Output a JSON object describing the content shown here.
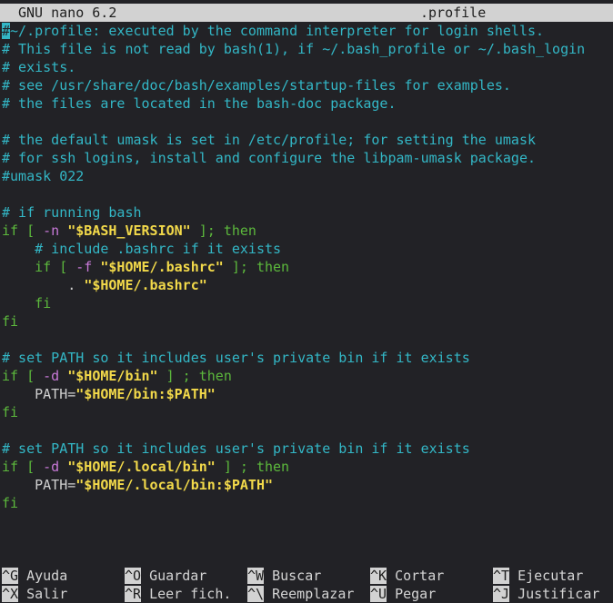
{
  "header": {
    "app_name": "GNU nano 6.2",
    "file_name": ".profile"
  },
  "editor": {
    "lines": [
      [
        [
          "cm",
          "~/.profile: executed by the command interpreter for login shells."
        ]
      ],
      [
        [
          "cm",
          "# This file is not read by bash(1), if ~/.bash_profile or ~/.bash_login"
        ]
      ],
      [
        [
          "cm",
          "# exists."
        ]
      ],
      [
        [
          "cm",
          "# see /usr/share/doc/bash/examples/startup-files for examples."
        ]
      ],
      [
        [
          "cm",
          "# the files are located in the bash-doc package."
        ]
      ],
      [],
      [
        [
          "cm",
          "# the default umask is set in /etc/profile; for setting the umask"
        ]
      ],
      [
        [
          "cm",
          "# for ssh logins, install and configure the libpam-umask package."
        ]
      ],
      [
        [
          "cm",
          "#umask 022"
        ]
      ],
      [],
      [
        [
          "cm",
          "# if running bash"
        ]
      ],
      [
        [
          "kw",
          "if"
        ],
        [
          "kw",
          " [ "
        ],
        [
          "op",
          "-n"
        ],
        [
          "pl",
          " "
        ],
        [
          "st",
          "\"$BASH_VERSION\""
        ],
        [
          "kw",
          " ]; then"
        ]
      ],
      [
        [
          "pl",
          "    "
        ],
        [
          "cm",
          "# include .bashrc if it exists"
        ]
      ],
      [
        [
          "pl",
          "    "
        ],
        [
          "kw",
          "if"
        ],
        [
          "kw",
          " [ "
        ],
        [
          "op",
          "-f"
        ],
        [
          "pl",
          " "
        ],
        [
          "st",
          "\"$HOME/.bashrc\""
        ],
        [
          "kw",
          " ]; then"
        ]
      ],
      [
        [
          "pl",
          "        . "
        ],
        [
          "st",
          "\"$HOME/.bashrc\""
        ]
      ],
      [
        [
          "pl",
          "    "
        ],
        [
          "kw",
          "fi"
        ]
      ],
      [
        [
          "kw",
          "fi"
        ]
      ],
      [],
      [
        [
          "cm",
          "# set PATH so it includes user's private bin if it exists"
        ]
      ],
      [
        [
          "kw",
          "if"
        ],
        [
          "kw",
          " [ "
        ],
        [
          "op",
          "-d"
        ],
        [
          "pl",
          " "
        ],
        [
          "st",
          "\"$HOME/bin\""
        ],
        [
          "kw",
          " ] ; then"
        ]
      ],
      [
        [
          "pl",
          "    PATH="
        ],
        [
          "st",
          "\"$HOME/bin:$PATH\""
        ]
      ],
      [
        [
          "kw",
          "fi"
        ]
      ],
      [],
      [
        [
          "cm",
          "# set PATH so it includes user's private bin if it exists"
        ]
      ],
      [
        [
          "kw",
          "if"
        ],
        [
          "kw",
          " [ "
        ],
        [
          "op",
          "-d"
        ],
        [
          "pl",
          " "
        ],
        [
          "st",
          "\"$HOME/.local/bin\""
        ],
        [
          "kw",
          " ] ; then"
        ]
      ],
      [
        [
          "pl",
          "    PATH="
        ],
        [
          "st",
          "\"$HOME/.local/bin:$PATH\""
        ]
      ],
      [
        [
          "kw",
          "fi"
        ]
      ]
    ],
    "cursor_char": "#"
  },
  "shortcuts": [
    {
      "key": "^G",
      "label": "Ayuda",
      "name": "shortcut-help"
    },
    {
      "key": "^O",
      "label": "Guardar",
      "name": "shortcut-write-out"
    },
    {
      "key": "^W",
      "label": "Buscar",
      "name": "shortcut-where-is"
    },
    {
      "key": "^K",
      "label": "Cortar",
      "name": "shortcut-cut"
    },
    {
      "key": "^T",
      "label": "Ejecutar",
      "name": "shortcut-execute"
    },
    {
      "key": "^X",
      "label": "Salir",
      "name": "shortcut-exit"
    },
    {
      "key": "^R",
      "label": "Leer fich.",
      "name": "shortcut-read-file"
    },
    {
      "key": "^\\",
      "label": "Reemplazar",
      "name": "shortcut-replace"
    },
    {
      "key": "^U",
      "label": "Pegar",
      "name": "shortcut-paste"
    },
    {
      "key": "^J",
      "label": "Justificar",
      "name": "shortcut-justify"
    }
  ],
  "colors": {
    "background": "#222226",
    "comment": "#33b7c6",
    "keyword": "#5cb83c",
    "operator": "#c879d8",
    "string": "#f2d94a",
    "bar": "#d2d2d2"
  }
}
